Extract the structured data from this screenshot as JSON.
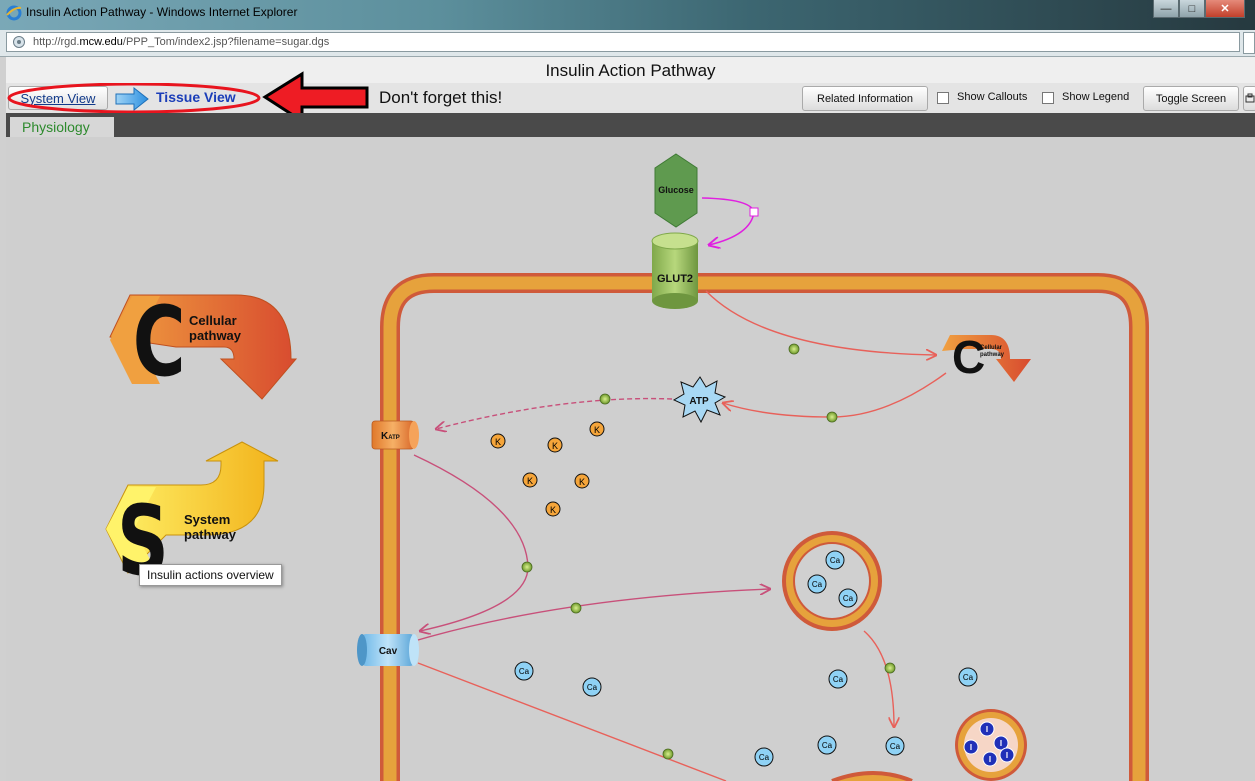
{
  "window": {
    "title": "Insulin Action Pathway - Windows Internet Explorer",
    "url_prefix": "http://rgd.",
    "url_domain": "mcw.edu",
    "url_suffix": "/PPP_Tom/index2.jsp?filename=sugar.dgs"
  },
  "app": {
    "title": "Insulin Action Pathway"
  },
  "toolbar": {
    "system_view": "System View",
    "tissue_view": "Tissue View",
    "annotation_note": "Don't forget this!",
    "related_information": "Related Information",
    "show_callouts": "Show Callouts",
    "show_legend": "Show Legend",
    "toggle_screen": "Toggle Screen"
  },
  "tabs": [
    "Physiology"
  ],
  "diagram": {
    "cellular_letter": "C",
    "cellular_line1": "Cellular",
    "cellular_line2": "pathway",
    "system_letter": "S",
    "system_line1": "System",
    "system_line2": "pathway",
    "tooltip": "Insulin actions overview",
    "glucose": "Glucose",
    "glut2": "GLUT2",
    "atp": "ATP",
    "katp_main": "K",
    "katp_sub": "ATP",
    "cav": "Cav",
    "k_ion": "K",
    "ca_ion": "Ca",
    "insulin_granule": "I"
  },
  "colors": {
    "membrane": "#e6a23c",
    "membrane_border": "#cf5a3a",
    "arrow": "#e8615a",
    "accent_blue": "#1a3db8",
    "annotation_red": "#e8141e"
  }
}
